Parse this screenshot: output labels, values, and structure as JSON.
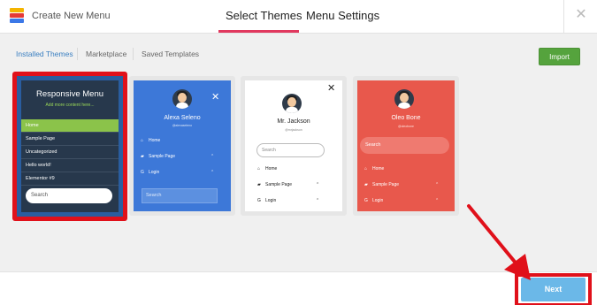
{
  "header": {
    "app_title": "Create New Menu",
    "tabs": [
      {
        "label": "Select Themes",
        "active": true
      },
      {
        "label": "Menu Settings",
        "active": false
      }
    ]
  },
  "subnav": {
    "tabs": [
      {
        "label": "Installed Themes",
        "active": true
      },
      {
        "label": "Marketplace",
        "active": false
      },
      {
        "label": "Saved Templates",
        "active": false
      }
    ],
    "import_label": "Import"
  },
  "themes": [
    {
      "selected": true,
      "title": "Responsive Menu",
      "subtitle": "Add more content here...",
      "items": [
        "Home",
        "Sample Page",
        "Uncategorized",
        "Hello world!",
        "Elementor #9"
      ],
      "search_placeholder": "Search",
      "colors": {
        "bg": "#27384c",
        "active": "#8bc34a"
      }
    },
    {
      "selected": false,
      "name": "Alexa Seleno",
      "email": "@alexaseleno",
      "items": [
        "Home",
        "Sample Page",
        "Login"
      ],
      "search_placeholder": "Search",
      "colors": {
        "bg": "#3d78d8"
      }
    },
    {
      "selected": false,
      "name": "Mr. Jackson",
      "email": "@mrjackson",
      "items": [
        "Home",
        "Sample Page",
        "Login"
      ],
      "search_placeholder": "Search",
      "colors": {
        "bg": "#ffffff"
      }
    },
    {
      "selected": false,
      "name": "Oleo Bone",
      "email": "@oleobone",
      "items": [
        "Home",
        "Sample Page",
        "Login"
      ],
      "search_placeholder": "Search",
      "colors": {
        "bg": "#e8584c"
      }
    }
  ],
  "footer": {
    "next_label": "Next"
  },
  "icons": {
    "close": "✕",
    "home": "⌂",
    "folder": "▰",
    "login": "G",
    "caret": "⌃"
  },
  "accent_colors": {
    "tab_underline": "#e1395f",
    "import": "#55a33d",
    "next": "#6bb8e8",
    "highlight": "#e0101a"
  }
}
